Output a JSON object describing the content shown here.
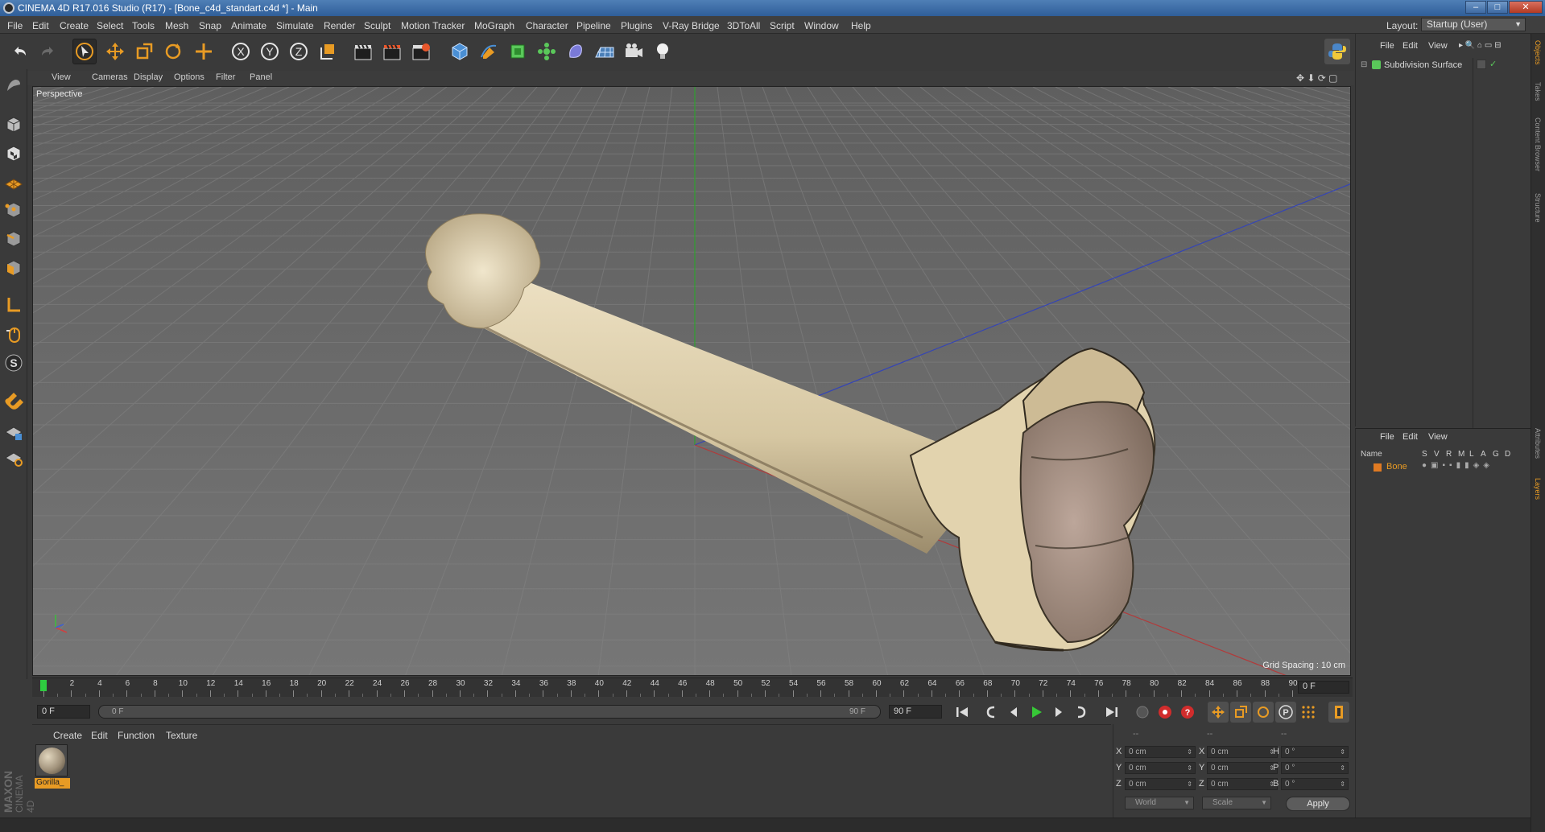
{
  "window": {
    "title": "CINEMA 4D R17.016 Studio (R17) - [Bone_c4d_standart.c4d *] - Main",
    "min": "–",
    "max": "□",
    "close": "✕"
  },
  "menubar": {
    "items": [
      "File",
      "Edit",
      "Create",
      "Select",
      "Tools",
      "Mesh",
      "Snap",
      "Animate",
      "Simulate",
      "Render",
      "Sculpt",
      "Motion Tracker",
      "MoGraph",
      "Character",
      "Pipeline",
      "Plugins",
      "V-Ray Bridge",
      "3DToAll",
      "Script",
      "Window",
      "Help"
    ],
    "layout_label": "Layout:",
    "layout_value": "Startup (User)"
  },
  "toolbar": {
    "axes": [
      "X",
      "Y",
      "Z"
    ]
  },
  "viewport": {
    "menu": [
      "View",
      "Cameras",
      "Display",
      "Options",
      "Filter",
      "Panel"
    ],
    "camera_label": "Perspective",
    "grid_spacing": "Grid Spacing : 10 cm",
    "colors": {
      "background": "#6f6f6f",
      "grid": "#7b7b7b",
      "x_axis": "#b03030",
      "y_axis": "#30a030",
      "z_axis": "#3040b0",
      "bone": "#d8cba9"
    }
  },
  "timeline": {
    "ticks": [
      "0",
      "2",
      "4",
      "6",
      "8",
      "10",
      "12",
      "14",
      "16",
      "18",
      "20",
      "22",
      "24",
      "26",
      "28",
      "30",
      "32",
      "34",
      "36",
      "38",
      "40",
      "42",
      "44",
      "46",
      "48",
      "50",
      "52",
      "54",
      "56",
      "58",
      "60",
      "62",
      "64",
      "66",
      "68",
      "70",
      "72",
      "74",
      "76",
      "78",
      "80",
      "82",
      "84",
      "86",
      "88",
      "90"
    ],
    "current_frame": "0 F",
    "frame_end_field": "0 F"
  },
  "playback": {
    "start_field": "0 F",
    "range_start": "0 F",
    "range_end": "90 F",
    "end_field": "90 F"
  },
  "material_manager": {
    "menu": [
      "Create",
      "Edit",
      "Function",
      "Texture"
    ],
    "materials": [
      {
        "name": "Gorilla_"
      }
    ]
  },
  "coordinates": {
    "header": [
      "--",
      "--",
      "--"
    ],
    "rows": [
      {
        "a_label": "X",
        "a_val": "0 cm",
        "b_label": "X",
        "b_val": "0 cm",
        "c_label": "H",
        "c_val": "0 °"
      },
      {
        "a_label": "Y",
        "a_val": "0 cm",
        "b_label": "Y",
        "b_val": "0 cm",
        "c_label": "P",
        "c_val": "0 °"
      },
      {
        "a_label": "Z",
        "a_val": "0 cm",
        "b_label": "Z",
        "b_val": "0 cm",
        "c_label": "B",
        "c_val": "0 °"
      }
    ],
    "mode_world": "World",
    "mode_scale": "Scale",
    "apply": "Apply"
  },
  "object_manager": {
    "menu": [
      "File",
      "Edit",
      "View"
    ],
    "objects": [
      {
        "name": "Subdivision Surface"
      }
    ]
  },
  "layer_manager": {
    "menu": [
      "File",
      "Edit",
      "View"
    ],
    "columns": [
      "Name",
      "S",
      "V",
      "R",
      "M",
      "L",
      "A",
      "G",
      "D"
    ],
    "layers": [
      {
        "name": "Bone",
        "color": "#e07a22"
      }
    ]
  },
  "side_tabs": [
    "Objects",
    "Takes",
    "Content Browser",
    "Structure",
    "Attributes",
    "Layers"
  ],
  "branding": {
    "maxon": "MAXON",
    "cinema": "CINEMA 4D"
  }
}
